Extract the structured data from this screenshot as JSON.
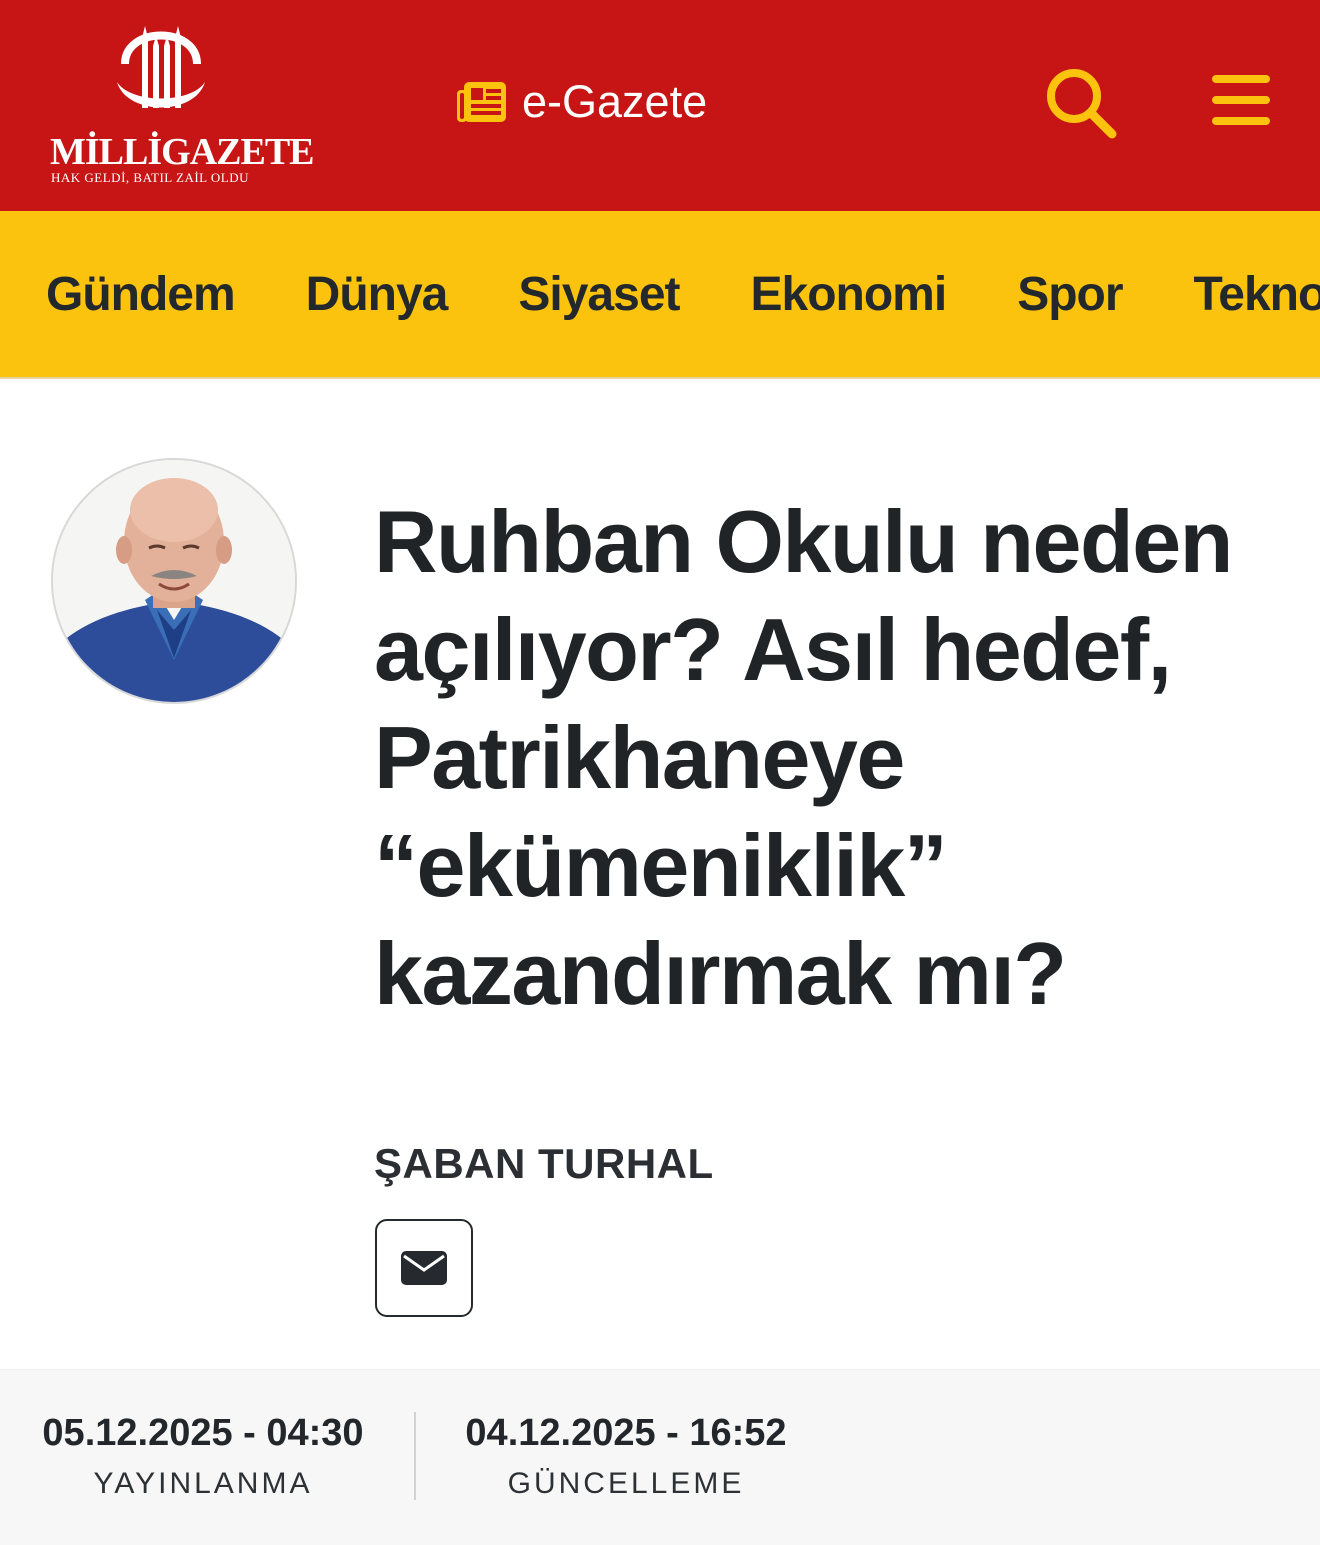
{
  "header": {
    "logo": {
      "wordmark": "MİLLİGAZETE",
      "tagline": "HAK GELDİ, BATIL ZAİL OLDU"
    },
    "egazete_label": "e-Gazete",
    "icons": {
      "egazete": "newspaper-icon",
      "search": "search-icon",
      "menu": "hamburger-menu-icon"
    },
    "colors": {
      "header_bg": "#c71414",
      "icon_accent": "#fcc30e",
      "nav_bg": "#fcc30e"
    }
  },
  "nav": {
    "items": [
      "Gündem",
      "Dünya",
      "Siyaset",
      "Ekonomi",
      "Spor",
      "Teknoloji"
    ]
  },
  "article": {
    "title": "Ruhban Okulu neden açılıyor? Asıl hedef, Patrikhaneye “ekümeniklik” kazandırmak mı?",
    "author": "ŞABAN TURHAL",
    "mail_icon": "envelope-icon"
  },
  "dates": {
    "published_value": "05.12.2025 - 04:30",
    "published_label": "YAYINLANMA",
    "updated_value": "04.12.2025 - 16:52",
    "updated_label": "GÜNCELLEME"
  }
}
